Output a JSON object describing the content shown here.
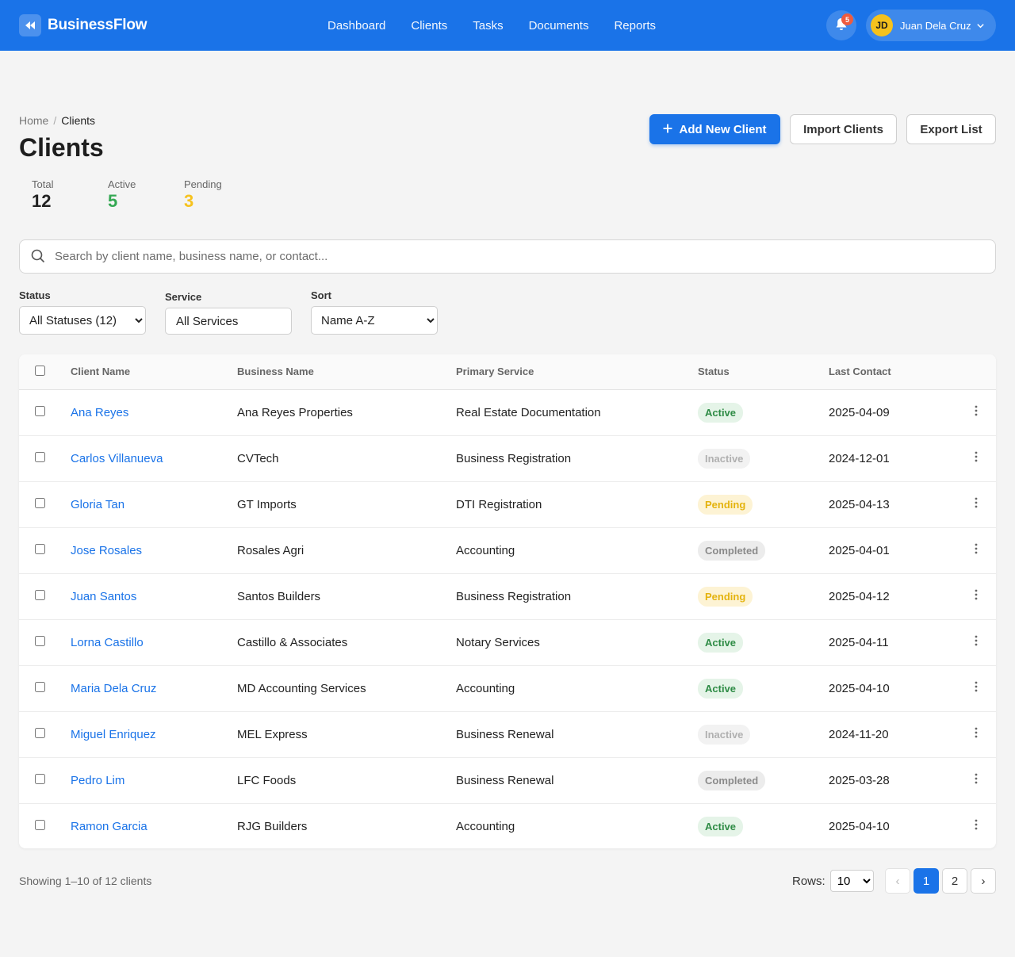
{
  "app": {
    "name": "BusinessFlow",
    "logo_icon": "rewind-icon"
  },
  "nav": {
    "items": [
      "Dashboard",
      "Clients",
      "Tasks",
      "Documents",
      "Reports"
    ]
  },
  "notifications": {
    "count": "5"
  },
  "user": {
    "initials": "JD",
    "name": "Juan Dela Cruz"
  },
  "breadcrumb": {
    "home": "Home",
    "separator": "/",
    "current": "Clients"
  },
  "page": {
    "title": "Clients"
  },
  "actions": {
    "add_label": "Add New Client",
    "import_label": "Import Clients",
    "export_label": "Export List"
  },
  "stats": [
    {
      "label": "Total",
      "value": "12",
      "color": "#222222"
    },
    {
      "label": "Active",
      "value": "5",
      "color": "#34a853"
    },
    {
      "label": "Pending",
      "value": "3",
      "color": "#f6c21d"
    }
  ],
  "search": {
    "placeholder": "Search by client name, business name, or contact..."
  },
  "filters": {
    "status": {
      "label": "Status",
      "value": "All Statuses (12)"
    },
    "service": {
      "label": "Service",
      "value": "All Services"
    },
    "sort": {
      "label": "Sort",
      "value": "Name A-Z"
    }
  },
  "table": {
    "columns": [
      "Client Name",
      "Business Name",
      "Primary Service",
      "Status",
      "Last Contact"
    ],
    "status_styles": {
      "Active": {
        "bg": "#e5f4e8",
        "fg": "#2e8b45"
      },
      "Inactive": {
        "bg": "#f2f2f2",
        "fg": "#b0b0b0"
      },
      "Pending": {
        "bg": "#fdf3d4",
        "fg": "#e4b30e"
      },
      "Completed": {
        "bg": "#ececec",
        "fg": "#8a8a8a"
      }
    },
    "rows": [
      {
        "client": "Ana Reyes",
        "business": "Ana Reyes Properties",
        "service": "Real Estate Documentation",
        "status": "Active",
        "last_contact": "2025-04-09"
      },
      {
        "client": "Carlos Villanueva",
        "business": "CVTech",
        "service": "Business Registration",
        "status": "Inactive",
        "last_contact": "2024-12-01"
      },
      {
        "client": "Gloria Tan",
        "business": "GT Imports",
        "service": "DTI Registration",
        "status": "Pending",
        "last_contact": "2025-04-13"
      },
      {
        "client": "Jose Rosales",
        "business": "Rosales Agri",
        "service": "Accounting",
        "status": "Completed",
        "last_contact": "2025-04-01"
      },
      {
        "client": "Juan Santos",
        "business": "Santos Builders",
        "service": "Business Registration",
        "status": "Pending",
        "last_contact": "2025-04-12"
      },
      {
        "client": "Lorna Castillo",
        "business": "Castillo & Associates",
        "service": "Notary Services",
        "status": "Active",
        "last_contact": "2025-04-11"
      },
      {
        "client": "Maria Dela Cruz",
        "business": "MD Accounting Services",
        "service": "Accounting",
        "status": "Active",
        "last_contact": "2025-04-10"
      },
      {
        "client": "Miguel Enriquez",
        "business": "MEL Express",
        "service": "Business Renewal",
        "status": "Inactive",
        "last_contact": "2024-11-20"
      },
      {
        "client": "Pedro Lim",
        "business": "LFC Foods",
        "service": "Business Renewal",
        "status": "Completed",
        "last_contact": "2025-03-28"
      },
      {
        "client": "Ramon Garcia",
        "business": "RJG Builders",
        "service": "Accounting",
        "status": "Active",
        "last_contact": "2025-04-10"
      }
    ]
  },
  "footer": {
    "showing": "Showing 1–10 of 12 clients",
    "rows_label": "Rows:",
    "rows_value": "10",
    "pages": [
      "1",
      "2"
    ],
    "prev": "‹",
    "next": "›"
  }
}
